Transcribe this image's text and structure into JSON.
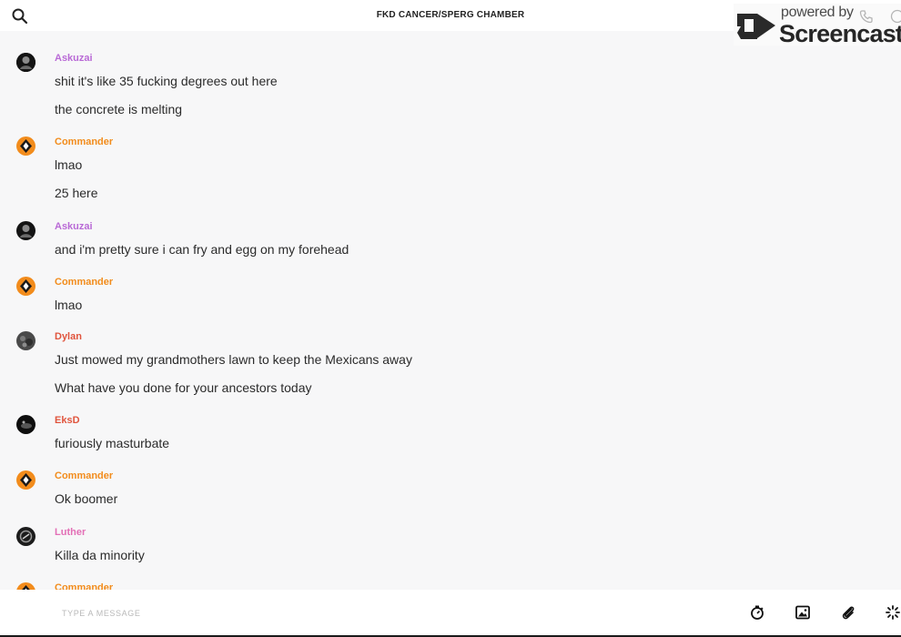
{
  "header": {
    "title": "FKD CANCER/SPERG CHAMBER"
  },
  "watermark": {
    "powered_by": "powered by",
    "brand": "Screencastify"
  },
  "colors": {
    "askuzai": "#b96ad6",
    "commander": "#f28c1c",
    "dylan": "#e0553e",
    "eksd": "#e0553e",
    "luther": "#e36fb6"
  },
  "messages": [
    {
      "author": "Askuzai",
      "lines": [
        "shit it's like 35 fucking degrees out here",
        "the concrete is melting"
      ]
    },
    {
      "author": "Commander",
      "lines": [
        "lmao",
        "25 here"
      ]
    },
    {
      "author": "Askuzai",
      "lines": [
        "and i'm pretty sure i can fry and egg on my forehead"
      ]
    },
    {
      "author": "Commander",
      "lines": [
        "lmao"
      ]
    },
    {
      "author": "Dylan",
      "lines": [
        "Just mowed my grandmothers lawn to keep the Mexicans away",
        "What have you done for your ancestors today"
      ]
    },
    {
      "author": "EksD",
      "lines": [
        "furiously masturbate"
      ]
    },
    {
      "author": "Commander",
      "lines": [
        "Ok boomer"
      ]
    },
    {
      "author": "Luther",
      "lines": [
        "Killa da minority"
      ]
    },
    {
      "author": "Commander",
      "lines": []
    }
  ],
  "composer": {
    "placeholder": "TYPE A MESSAGE",
    "icons": [
      "timer-icon",
      "image-icon",
      "attachment-icon",
      "loading-icon"
    ]
  }
}
